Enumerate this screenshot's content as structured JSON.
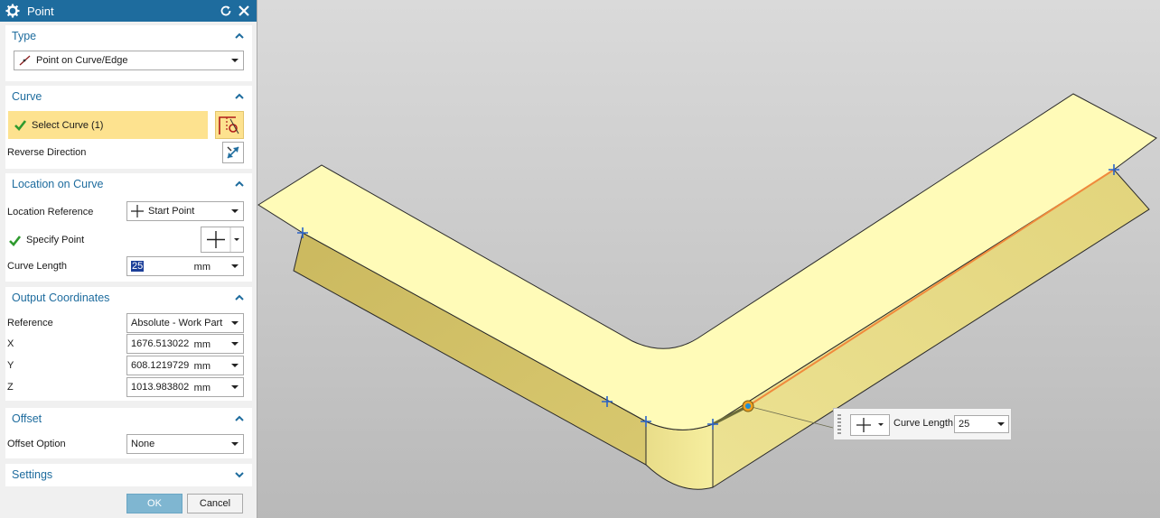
{
  "dialog": {
    "title": "Point",
    "icons": [
      "gear-icon",
      "reset-icon",
      "close-icon"
    ]
  },
  "type_group": {
    "title": "Type",
    "type_value": "Point on Curve/Edge"
  },
  "curve_group": {
    "title": "Curve",
    "select_curve_label": "Select Curve (1)",
    "reverse_direction_label": "Reverse Direction"
  },
  "location_group": {
    "title": "Location on Curve",
    "location_reference_label": "Location Reference",
    "location_reference_value": "Start Point",
    "specify_point_label": "Specify Point",
    "curve_length_label": "Curve Length",
    "curve_length_value": "25",
    "curve_length_unit": "mm"
  },
  "output_group": {
    "title": "Output Coordinates",
    "reference_label": "Reference",
    "reference_value": "Absolute - Work Part",
    "x_label": "X",
    "x_value": "1676.513022",
    "y_label": "Y",
    "y_value": "608.1219729",
    "z_label": "Z",
    "z_value": "1013.983802",
    "unit": "mm"
  },
  "offset_group": {
    "title": "Offset",
    "offset_option_label": "Offset Option",
    "offset_option_value": "None"
  },
  "settings_group": {
    "title": "Settings"
  },
  "buttons": {
    "ok": "OK",
    "cancel": "Cancel"
  },
  "float_widget": {
    "label": "Curve Length",
    "value": "25"
  },
  "colors": {
    "accent": "#1e6c9e",
    "selection": "#fde28f",
    "part_top": "#fffbb8",
    "part_side": "#d4c36c",
    "edge_highlight": "#f08a3c",
    "marker": "#2a63c9"
  }
}
